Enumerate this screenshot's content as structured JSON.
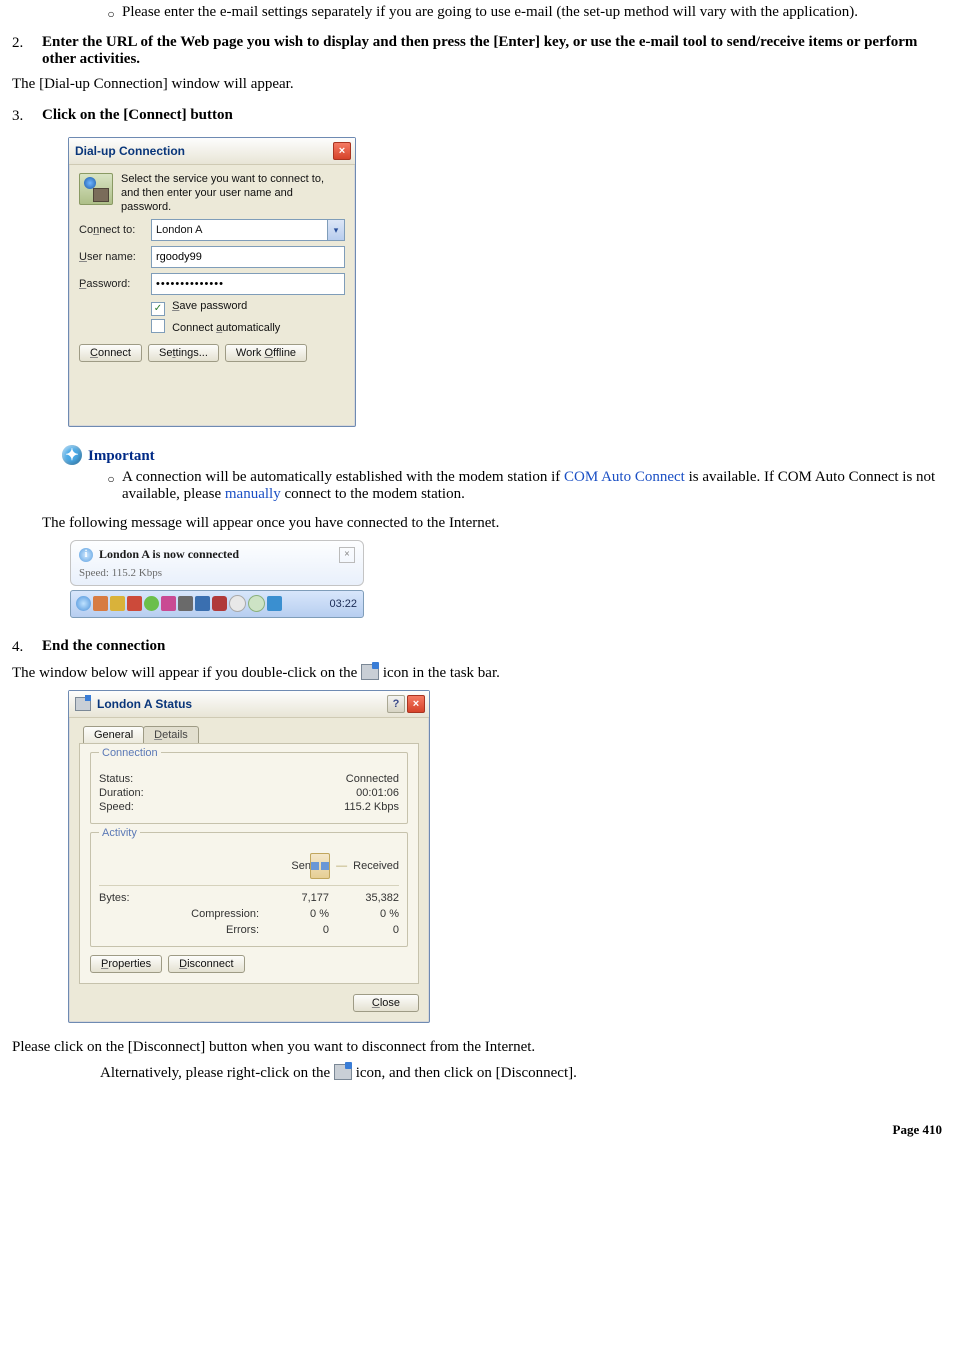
{
  "bullets": {
    "email_note": "Please enter the e-mail settings separately if you are going to use e-mail (the set-up method will vary with the application)."
  },
  "steps": {
    "s2": {
      "num": "2.",
      "title": "Enter the URL of the Web page you wish to display and then press the [Enter] key, or use the e-mail tool to send/receive items or perform other activities.",
      "after": "The [Dial-up Connection] window will appear."
    },
    "s3": {
      "num": "3.",
      "title": "Click on the [Connect] button"
    },
    "s4": {
      "num": "4.",
      "title": "End the connection",
      "line1a": "The window below will appear if you double-click on the ",
      "line1b": " icon in the task bar.",
      "line2": "Please click on the [Disconnect] button when you want to disconnect from the Internet.",
      "line3a": "Alternatively, please right-click on the ",
      "line3b": " icon, and then click on [Disconnect]."
    }
  },
  "dialup_dialog": {
    "title": "Dial-up Connection",
    "intro": "Select the service you want to connect to, and then enter your user name and password.",
    "labels": {
      "connect_to": "Connect to:",
      "user_name": "User name:",
      "password": "Password:"
    },
    "values": {
      "service": "London A",
      "user": "rgoody99",
      "password_mask": "••••••••••••••"
    },
    "checks": {
      "save_pw": "Save password",
      "auto": "Connect automatically"
    },
    "save_pw_checked": "✓",
    "buttons": {
      "connect": "Connect",
      "settings": "Settings...",
      "offline": "Work Offline"
    },
    "underlines": {
      "connect_to": "n",
      "user": "U",
      "pw": "P",
      "save": "S",
      "auto": "a",
      "connect_btn": "C",
      "settings_btn": "t",
      "offline_btn": "O"
    }
  },
  "important": {
    "heading": "Important",
    "text_a": "A connection will be automatically established with the modem station if ",
    "link1": "COM Auto Connect",
    "text_b": " is available. If COM Auto Connect is not available, please ",
    "link2": "manually",
    "text_c": " connect to the modem station."
  },
  "after_important": "The following message will appear once you have connected to the Internet.",
  "balloon": {
    "title": "London A is now connected",
    "sub": "Speed: 115.2 Kbps",
    "clock": "03:22"
  },
  "status_dialog": {
    "title": "London A Status",
    "tabs": {
      "general": "General",
      "details": "Details"
    },
    "groups": {
      "conn": "Connection",
      "activity": "Activity"
    },
    "conn": {
      "status_k": "Status:",
      "status_v": "Connected",
      "dur_k": "Duration:",
      "dur_v": "00:01:06",
      "speed_k": "Speed:",
      "speed_v": "115.2 Kbps"
    },
    "activity": {
      "sent_h": "Sent",
      "dash": "—",
      "recv_h": "Received",
      "bytes_k": "Bytes:",
      "bytes_sent": "7,177",
      "bytes_recv": "35,382",
      "comp_k": "Compression:",
      "comp_sent": "0 %",
      "comp_recv": "0 %",
      "err_k": "Errors:",
      "err_sent": "0",
      "err_recv": "0"
    },
    "buttons": {
      "props": "Properties",
      "disc": "Disconnect",
      "close": "Close"
    }
  },
  "page_label": "Page 410"
}
